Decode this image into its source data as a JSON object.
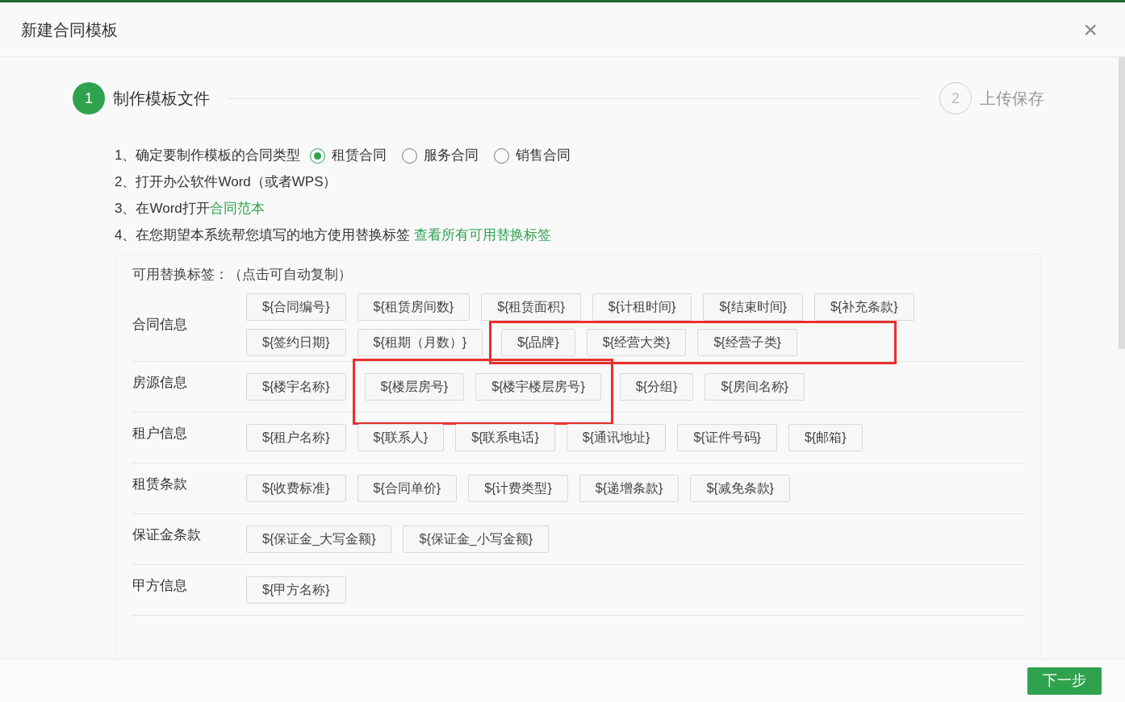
{
  "dialog": {
    "title": "新建合同模板",
    "close": "×"
  },
  "steps": [
    {
      "number": "1",
      "label": "制作模板文件",
      "active": true
    },
    {
      "number": "2",
      "label": "上传保存",
      "active": false
    }
  ],
  "instructions": [
    {
      "kind": "radio",
      "text": "1、确定要制作模板的合同类型",
      "options": [
        {
          "label": "租赁合同",
          "selected": true
        },
        {
          "label": "服务合同",
          "selected": false
        },
        {
          "label": "销售合同",
          "selected": false
        }
      ]
    },
    {
      "kind": "plain",
      "text": "2、打开办公软件Word（或者WPS）"
    },
    {
      "kind": "link",
      "text": "3、在Word打开",
      "link": "合同范本"
    },
    {
      "kind": "link",
      "text": "4、在您期望本系统帮您填写的地方使用替换标签 ",
      "link": "查看所有可用替换标签"
    }
  ],
  "tag_panel": {
    "title": "可用替换标签：（点击可自动复制）",
    "groups": [
      {
        "label": "合同信息",
        "lines": [
          [
            {
              "framed": false,
              "tags": [
                "${合同编号}",
                "${租赁房间数}",
                "${租赁面积}",
                "${计租时间}",
                "${结束时间}",
                "${补充条款}"
              ]
            }
          ],
          [
            {
              "framed": false,
              "tags": [
                "${签约日期}",
                "${租期（月数）}"
              ]
            },
            {
              "framed": true,
              "tags": [
                "${品牌}",
                "${经营大类}",
                "${经营子类}"
              ]
            }
          ]
        ]
      },
      {
        "label": "房源信息",
        "lines": [
          [
            {
              "framed": false,
              "tags": [
                "${楼宇名称}"
              ]
            },
            {
              "framed": true,
              "tags": [
                "${楼层房号}",
                "${楼宇楼层房号}"
              ]
            },
            {
              "framed": false,
              "tags": [
                "${分组}",
                "${房间名称}"
              ]
            }
          ]
        ]
      },
      {
        "label": "租户信息",
        "lines": [
          [
            {
              "framed": false,
              "tags": [
                "${租户名称}",
                "${联系人}",
                "${联系电话}",
                "${通讯地址}",
                "${证件号码}",
                "${邮箱}"
              ]
            }
          ]
        ]
      },
      {
        "label": "租赁条款",
        "lines": [
          [
            {
              "framed": false,
              "tags": [
                "${收费标准}",
                "${合同单价}",
                "${计费类型}",
                "${递增条款}",
                "${减免条款}"
              ]
            }
          ]
        ]
      },
      {
        "label": "保证金条款",
        "lines": [
          [
            {
              "framed": false,
              "tags": [
                "${保证金_大写金额}",
                "${保证金_小写金额}"
              ]
            }
          ]
        ]
      },
      {
        "label": "甲方信息",
        "lines": [
          [
            {
              "framed": false,
              "tags": [
                "${甲方名称}"
              ]
            }
          ]
        ]
      }
    ]
  },
  "footer": {
    "next_button": "下一步"
  }
}
